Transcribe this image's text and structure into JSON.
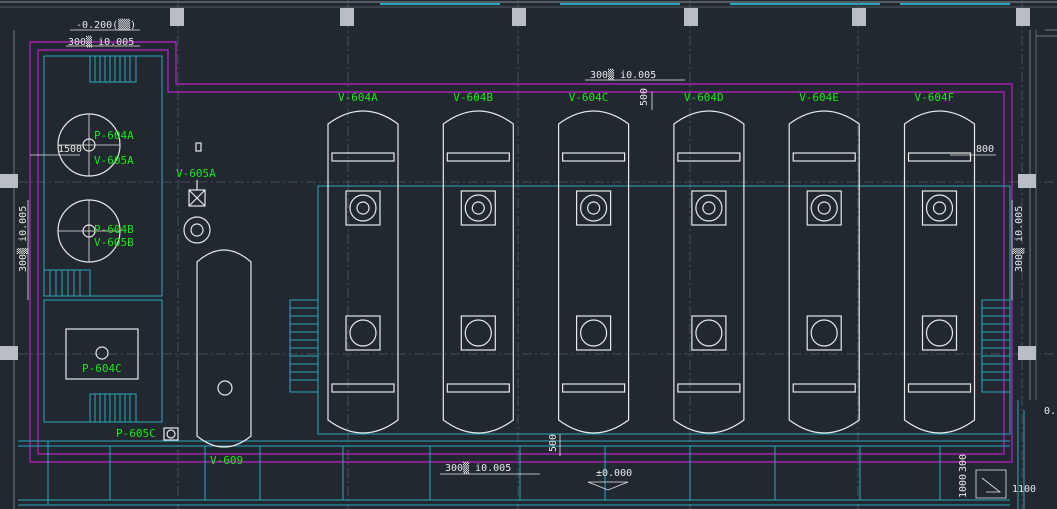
{
  "drawing": {
    "tanks": [
      "V-604A",
      "V-604B",
      "V-604C",
      "V-604D",
      "V-604E",
      "V-604F"
    ],
    "pumps": {
      "p604a": "P-604A",
      "v605a_lower": "V-605A",
      "p604b": "P-604B",
      "v605b": "V-605B",
      "p604c": "P-604C",
      "p605c": "P-605C"
    },
    "v605a_label": "V-605A",
    "v609_label": "V-609",
    "dims": {
      "top_level": "-0.200(▒▒)",
      "top_left_slope": "300▒ i0.005",
      "top_slope": "300▒ i0.005",
      "left_slope": "300▒ i0.005",
      "right_slope": "300▒ i0.005",
      "bottom_slope": "300▒ i0.005",
      "dim_1500": "1500",
      "dim_500_top": "500",
      "dim_800": "800",
      "dim_500_bottom": "500",
      "elev_000": "±0.000",
      "dim_1000": "1000",
      "dim_300": "300",
      "dim_1100": "1100",
      "right_edge": "0."
    },
    "colors": {
      "background": "#212830",
      "equipment": "#e8e8e8",
      "label": "#19e619",
      "dike": "#c020c8",
      "trench": "#2aa8c0"
    }
  }
}
